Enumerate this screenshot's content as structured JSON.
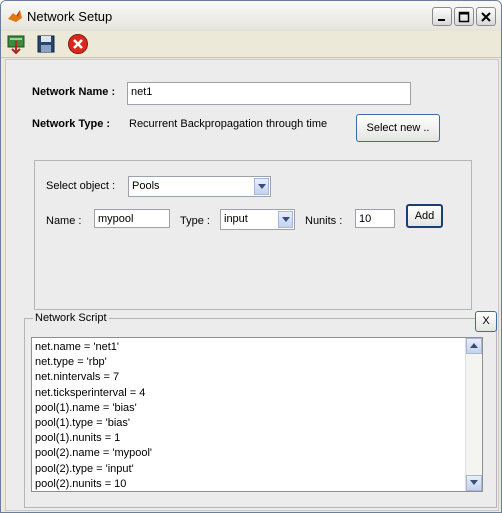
{
  "window": {
    "title": "Network Setup"
  },
  "toolbar": {
    "items": [
      {
        "name": "load-tool-icon"
      },
      {
        "name": "save-tool-icon"
      },
      {
        "name": "close-tool-icon"
      }
    ]
  },
  "form": {
    "network_name_label": "Network Name :",
    "network_name_value": "net1",
    "network_type_label": "Network Type :",
    "network_type_value": "Recurrent Backpropagation through time",
    "select_new_button": "Select new ..",
    "select_object_label": "Select object :",
    "select_object_value": "Pools",
    "name_label": "Name :",
    "name_value": "mypool",
    "type_label": "Type :",
    "type_value": "input",
    "nunits_label": "Nunits :",
    "nunits_value": "10",
    "add_button": "Add"
  },
  "script": {
    "group_label": "Network Script",
    "close_button": "X",
    "lines": [
      "net.name = 'net1'",
      "net.type = 'rbp'",
      "net.nintervals = 7",
      "net.ticksperinterval = 4",
      "pool(1).name = 'bias'",
      "pool(1).type = 'bias'",
      "pool(1).nunits = 1",
      "pool(2).name = 'mypool'",
      "pool(2).type = 'input'",
      "pool(2).nunits = 10"
    ]
  },
  "colors": {
    "title_bg": "#ece9d8",
    "close_icon_red": "#d9291b",
    "button_border": "#3d6aa7"
  }
}
